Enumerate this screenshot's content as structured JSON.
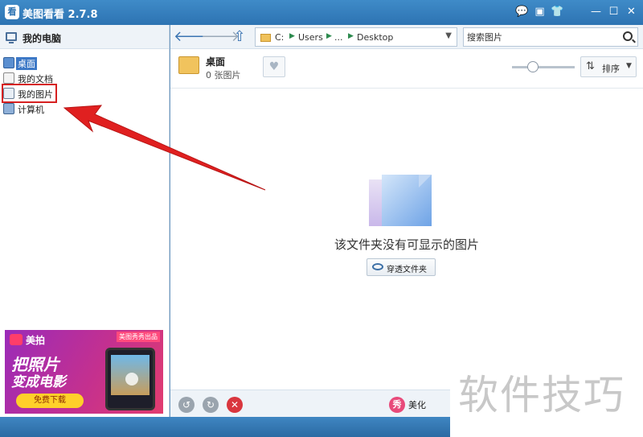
{
  "window": {
    "logo_text": "看",
    "title": "美图看看 2.7.8",
    "controls": [
      "💬",
      "▣",
      "👕",
      "—",
      "☐",
      "✕"
    ]
  },
  "sidebar": {
    "header": "我的电脑",
    "items": [
      {
        "label": "桌面",
        "icon": "desktop-icon",
        "selected": true
      },
      {
        "label": "我的文档",
        "icon": "documents-icon",
        "selected": false
      },
      {
        "label": "我的图片",
        "icon": "pictures-icon",
        "selected": false
      },
      {
        "label": "计算机",
        "icon": "computer-icon",
        "selected": false
      }
    ]
  },
  "ad": {
    "brand": "美拍",
    "tag": "美图秀秀出品",
    "line1": "把照片",
    "line2": "变成电影",
    "button": "免费下载"
  },
  "toolbar": {
    "back": "🡐",
    "forward": "🡒",
    "up": "⇧",
    "path": [
      "C:",
      "Users",
      "...",
      "Desktop"
    ],
    "search_placeholder": "搜索图片"
  },
  "folder": {
    "name": "桌面",
    "count": "0 张图片"
  },
  "sort": {
    "label": "排序"
  },
  "empty": {
    "message": "该文件夹没有可显示的图片",
    "button": "穿透文件夹"
  },
  "status": {
    "beautify_icon": "秀",
    "beautify_label": "美化"
  },
  "watermark": {
    "text": "软件技巧"
  },
  "colors": {
    "titlebar": "#2d73b2",
    "selection": "#3c78c6",
    "highlight_box": "#d62020",
    "annotation_arrow": "#e02020"
  }
}
